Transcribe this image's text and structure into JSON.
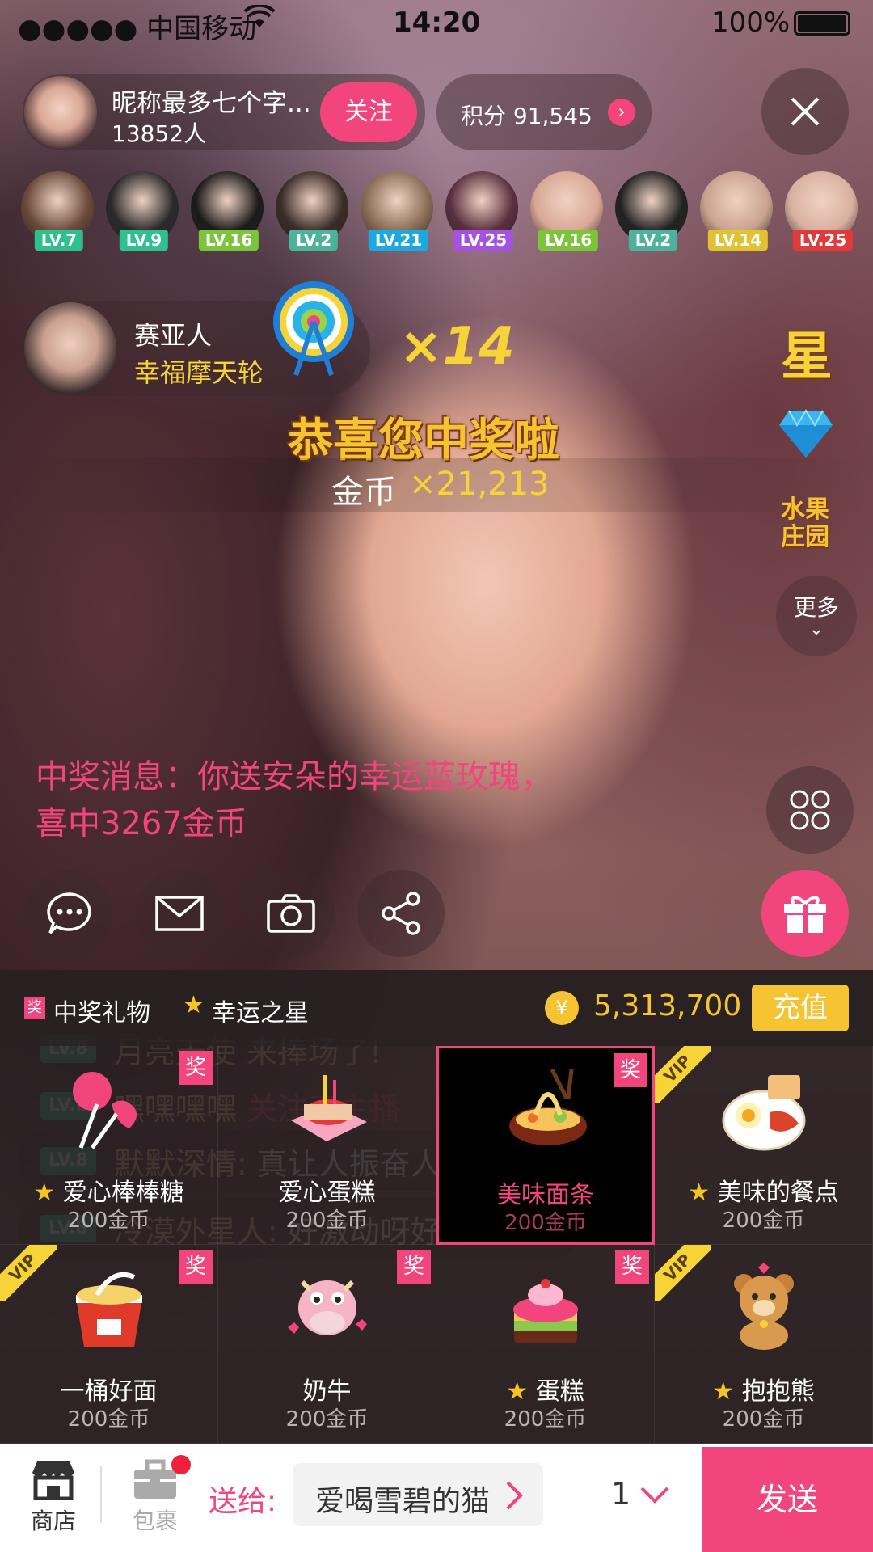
{
  "status": {
    "carrier": "●●●●● 中国移动",
    "time": "14:20",
    "battery": "100%"
  },
  "host": {
    "nickname": "昵称最多七个字...",
    "followers": "13852人",
    "follow_label": "关注"
  },
  "points": {
    "label": "积分 91,545"
  },
  "viewers": [
    {
      "level": "LV.7",
      "color": "#2cc18e"
    },
    {
      "level": "LV.9",
      "color": "#2cc18e"
    },
    {
      "level": "LV.16",
      "color": "#7cc43a"
    },
    {
      "level": "LV.2",
      "color": "#4bb39b"
    },
    {
      "level": "LV.21",
      "color": "#1ea8e0"
    },
    {
      "level": "LV.25",
      "color": "#a552e0"
    },
    {
      "level": "LV.16",
      "color": "#7cc43a"
    },
    {
      "level": "LV.2",
      "color": "#4bb39b"
    },
    {
      "level": "LV.14",
      "color": "#e2c230"
    },
    {
      "level": "LV.25",
      "color": "#e03a3a"
    }
  ],
  "gift_notice": {
    "sender": "赛亚人",
    "gift": "幸福摩天轮",
    "count": "×14"
  },
  "prize": {
    "title": "恭喜您中奖啦",
    "coin_label": "金币",
    "coin_amount": "×21,213"
  },
  "side_icons": {
    "star": "星",
    "farm_line1": "水果",
    "farm_line2": "庄园",
    "more": "更多"
  },
  "chat": [
    {
      "level": "LV.8",
      "name": "月亮天使",
      "text": " 来捧场了!",
      "style": "plain"
    },
    {
      "level": "LV.8",
      "name": "嘿嘿嘿嘿",
      "text": " 关注了主播",
      "style": "pink"
    },
    {
      "level": "LV.8",
      "name": "默默深情:",
      "text": " 真让人振奋人心~",
      "style": "bubble"
    },
    {
      "level": "LV.8",
      "name": "冷漠外星人:",
      "text": " 好激动呀好激动呀~",
      "style": "bubble"
    }
  ],
  "prize_message": "中奖消息：你送安朵的幸运蓝玫瑰，喜中3267金币",
  "tabs": {
    "tab1": "中奖礼物",
    "tab1_badge": "奖",
    "tab2": "幸运之星",
    "balance": "5,313,700",
    "recharge": "充值"
  },
  "gifts": [
    {
      "name": "爱心棒棒糖",
      "price": "200金币",
      "star": true,
      "badge": "奖",
      "vip": false
    },
    {
      "name": "爱心蛋糕",
      "price": "200金币",
      "star": false,
      "badge": "",
      "vip": false
    },
    {
      "name": "美味面条",
      "price": "200金币",
      "star": false,
      "badge": "奖",
      "vip": false,
      "selected": true
    },
    {
      "name": "美味的餐点",
      "price": "200金币",
      "star": true,
      "badge": "",
      "vip": true
    },
    {
      "name": "一桶好面",
      "price": "200金币",
      "star": false,
      "badge": "奖",
      "vip": true
    },
    {
      "name": "奶牛",
      "price": "200金币",
      "star": false,
      "badge": "奖",
      "vip": false
    },
    {
      "name": "蛋糕",
      "price": "200金币",
      "star": true,
      "badge": "奖",
      "vip": false
    },
    {
      "name": "抱抱熊",
      "price": "200金币",
      "star": true,
      "badge": "",
      "vip": true
    }
  ],
  "vip_label": "VIP",
  "bottom": {
    "shop": "商店",
    "bag": "包裹",
    "send_to_label": "送给:",
    "recipient": "爱喝雪碧的猫",
    "quantity": "1",
    "send": "发送"
  }
}
